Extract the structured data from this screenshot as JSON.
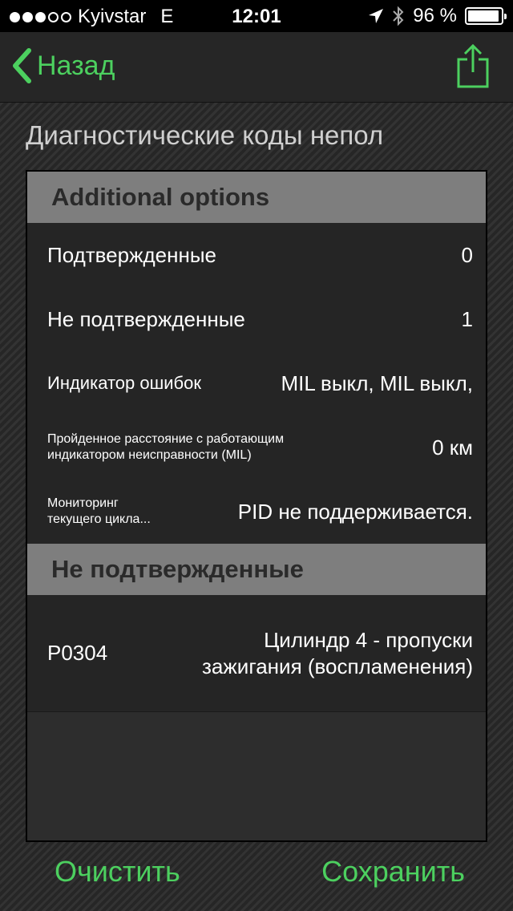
{
  "status_bar": {
    "carrier": "Kyivstar",
    "network": "E",
    "time": "12:01",
    "battery": "96 %",
    "battery_level": 0.96,
    "icons": [
      "signal-dots-icon",
      "location-arrow-icon",
      "bluetooth-icon",
      "battery-icon"
    ]
  },
  "nav": {
    "back_label": "Назад",
    "accent_color": "#4cd05f"
  },
  "page": {
    "title": "Диагностические коды непол"
  },
  "sections": {
    "additional": {
      "header": "Additional options",
      "rows": [
        {
          "label": "Подтвержденные",
          "value": "0"
        },
        {
          "label": "Не подтвержденные",
          "value": "1"
        },
        {
          "label": "Индикатор ошибок",
          "value": "MIL выкл, MIL выкл,"
        },
        {
          "label": "Пройденное расстояние с работающим индикатором неисправности (MIL)",
          "value": "0 км"
        },
        {
          "label": "Мониторинг текущего цикла...",
          "value": "PID не поддерживается."
        }
      ]
    },
    "unconfirmed": {
      "header": "Не подтвержденные",
      "codes": [
        {
          "code": "P0304",
          "description": "Цилиндр 4 - пропуски зажигания (воспламенения)"
        }
      ]
    }
  },
  "footer": {
    "clear_label": "Очистить",
    "save_label": "Сохранить"
  }
}
